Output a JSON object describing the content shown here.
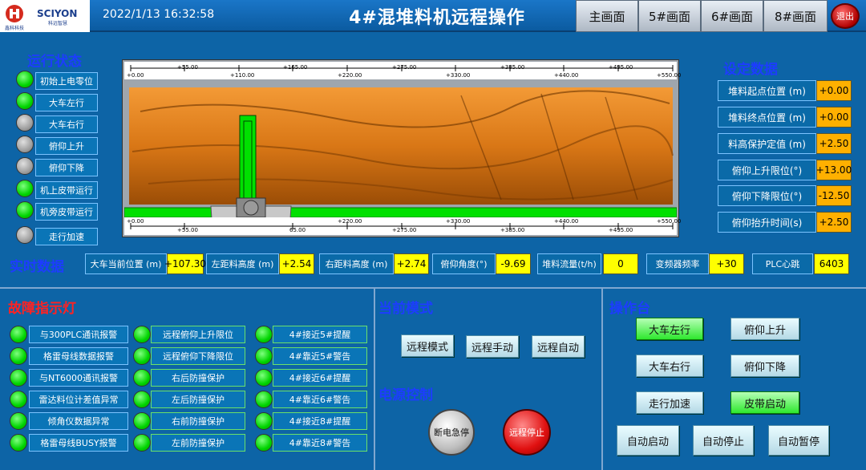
{
  "header": {
    "brand": "SCIYON",
    "brand_sub": "科远智慧",
    "logo_caption": "鑫科科技",
    "datetime": "2022/1/13 16:32:58",
    "title": "4#混堆料机远程操作",
    "nav": [
      "主画面",
      "5#画面",
      "6#画面",
      "8#画面"
    ],
    "exit_label": "退出"
  },
  "run_status": {
    "title": "运行状态",
    "items": [
      {
        "label": "初始上电零位",
        "on": true
      },
      {
        "label": "大车左行",
        "on": true
      },
      {
        "label": "大车右行",
        "on": false
      },
      {
        "label": "俯仰上升",
        "on": false
      },
      {
        "label": "俯仰下降",
        "on": false
      },
      {
        "label": "机上皮带运行",
        "on": true
      },
      {
        "label": "机旁皮带运行",
        "on": true
      },
      {
        "label": "走行加速",
        "on": false
      }
    ]
  },
  "ruler": {
    "top_ticks": [
      "+0.00",
      "+55.00",
      "+110.00",
      "+165.00",
      "+220.00",
      "+275.00",
      "+330.00",
      "+385.00",
      "+440.00",
      "+495.00",
      "+550.00"
    ],
    "bottom_ticks": [
      "+0.00",
      "+55.00",
      "65.00",
      "+220.00",
      "+275.00",
      "+330.00",
      "+385.00",
      "+440.00",
      "+495.00",
      "+550.00"
    ]
  },
  "settings": {
    "title": "设定数据",
    "items": [
      {
        "label": "堆料起点位置 (m)",
        "value": "+0.00"
      },
      {
        "label": "堆料终点位置 (m)",
        "value": "+0.00"
      },
      {
        "label": "料高保护定值 (m)",
        "value": "+2.50"
      },
      {
        "label": "俯仰上升限位(°)",
        "value": "+13.00"
      },
      {
        "label": "俯仰下降限位(°)",
        "value": "-12.50"
      },
      {
        "label": "俯仰抬升时间(s)",
        "value": "+2.50"
      }
    ]
  },
  "realtime": {
    "title": "实时数据",
    "items": [
      {
        "label": "大车当前位置 (m)",
        "value": "+107.30"
      },
      {
        "label": "左距料高度 (m)",
        "value": "+2.54"
      },
      {
        "label": "右距料高度 (m)",
        "value": "+2.74"
      },
      {
        "label": "俯仰角度(°)",
        "value": "-9.69"
      },
      {
        "label": "堆料流量(t/h)",
        "value": "0"
      },
      {
        "label": "变频器频率",
        "value": "+30"
      },
      {
        "label": "PLC心跳",
        "value": "6403"
      }
    ]
  },
  "faults": {
    "title": "故障指示灯",
    "col1": [
      "与300PLC通讯报警",
      "格雷母线数据报警",
      "与NT6000通讯报警",
      "雷达料位计差值异常",
      "倾角仪数据异常",
      "格雷母线BUSY报警"
    ],
    "col2": [
      "远程俯仰上升限位",
      "远程俯仰下降限位",
      "右后防撞保护",
      "左后防撞保护",
      "右前防撞保护",
      "左前防撞保护"
    ],
    "col3": [
      "4#接近5#提醒",
      "4#靠近5#警告",
      "4#接近6#提醒",
      "4#靠近6#警告",
      "4#接近8#提醒",
      "4#靠近8#警告"
    ]
  },
  "mode": {
    "title": "当前模式",
    "buttons": [
      "远程模式",
      "远程手动",
      "远程自动"
    ]
  },
  "power": {
    "title": "电源控制",
    "emergency": "断电急停",
    "remote_stop": "远程停止"
  },
  "console": {
    "title": "操作台",
    "buttons": [
      {
        "label": "大车左行",
        "active": true
      },
      {
        "label": "俯仰上升",
        "active": false
      },
      {
        "label": "大车右行",
        "active": false
      },
      {
        "label": "俯仰下降",
        "active": false
      },
      {
        "label": "走行加速",
        "active": false
      },
      {
        "label": "皮带启动",
        "active": true
      },
      {
        "label": "自动启动",
        "active": false
      },
      {
        "label": "自动停止",
        "active": false
      },
      {
        "label": "自动暂停",
        "active": false
      }
    ]
  },
  "colors": {
    "bg": "#0d64a6",
    "led_on": "#00d400",
    "led_off": "#9a9a9a",
    "pile": "#e07a1c",
    "value_yellow": "#ffff00",
    "value_orange": "#ffb000"
  }
}
